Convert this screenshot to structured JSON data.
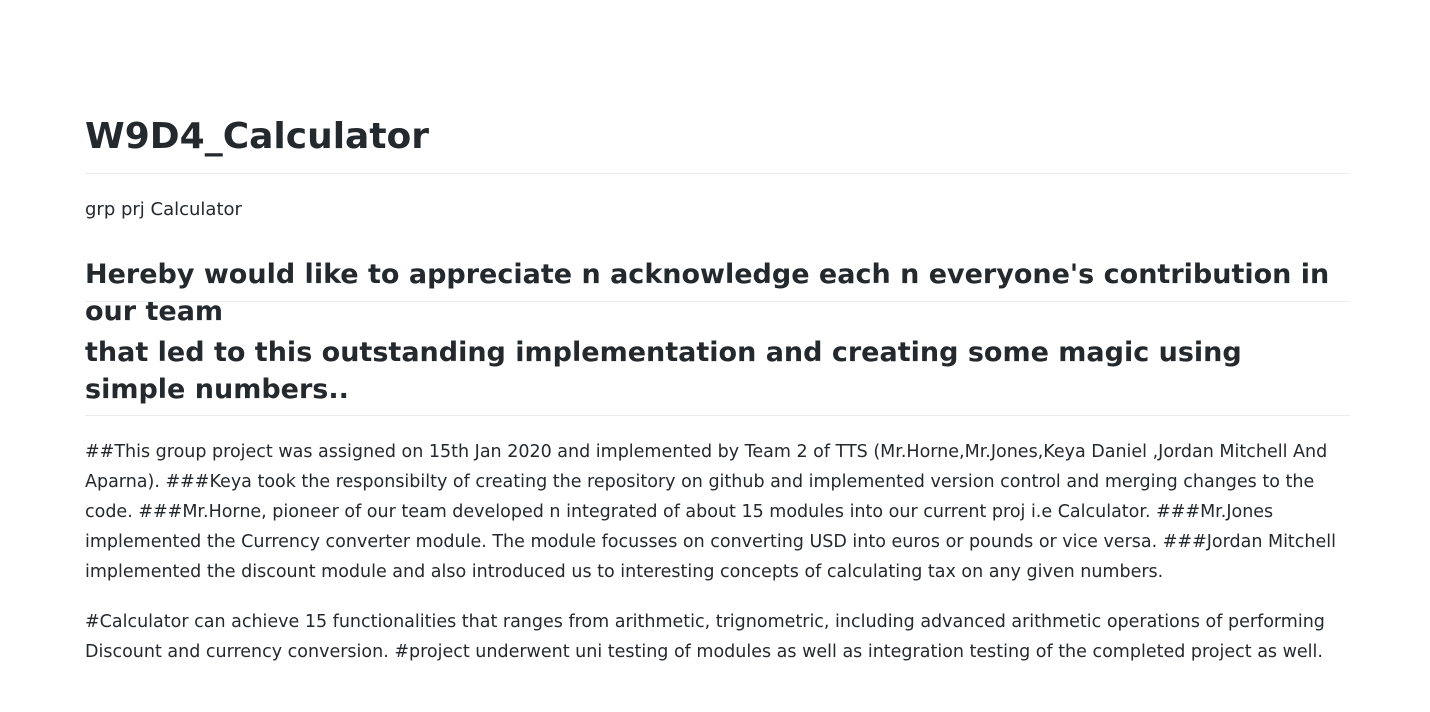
{
  "readme": {
    "title": "W9D4_Calculator",
    "description": "grp prj Calculator",
    "heading_1": "Hereby would like to appreciate n acknowledge each n everyone's contribution in our team",
    "heading_2": "that led to this outstanding implementation and creating some magic using simple numbers..",
    "paragraph_1": "##This group project was assigned on 15th Jan 2020 and implemented by Team 2 of TTS (Mr.Horne,Mr.Jones,Keya Daniel ,Jordan Mitchell And Aparna). ###Keya took the responsibilty of creating the repository on github and implemented version control and merging changes to the code. ###Mr.Horne, pioneer of our team developed n integrated of about 15 modules into our current proj i.e Calculator. ###Mr.Jones implemented the Currency converter module. The module focusses on converting USD into euros or pounds or vice versa. ###Jordan Mitchell implemented the discount module and also introduced us to interesting concepts of calculating tax on any given numbers.",
    "paragraph_2": "#Calculator can achieve 15 functionalities that ranges from arithmetic, trignometric, including advanced arithmetic operations of performing Discount and currency conversion. #project underwent uni testing of modules as well as integration testing of the completed project as well."
  },
  "colors": {
    "text": "#24292e",
    "rule": "#eaecef",
    "background": "#ffffff"
  }
}
